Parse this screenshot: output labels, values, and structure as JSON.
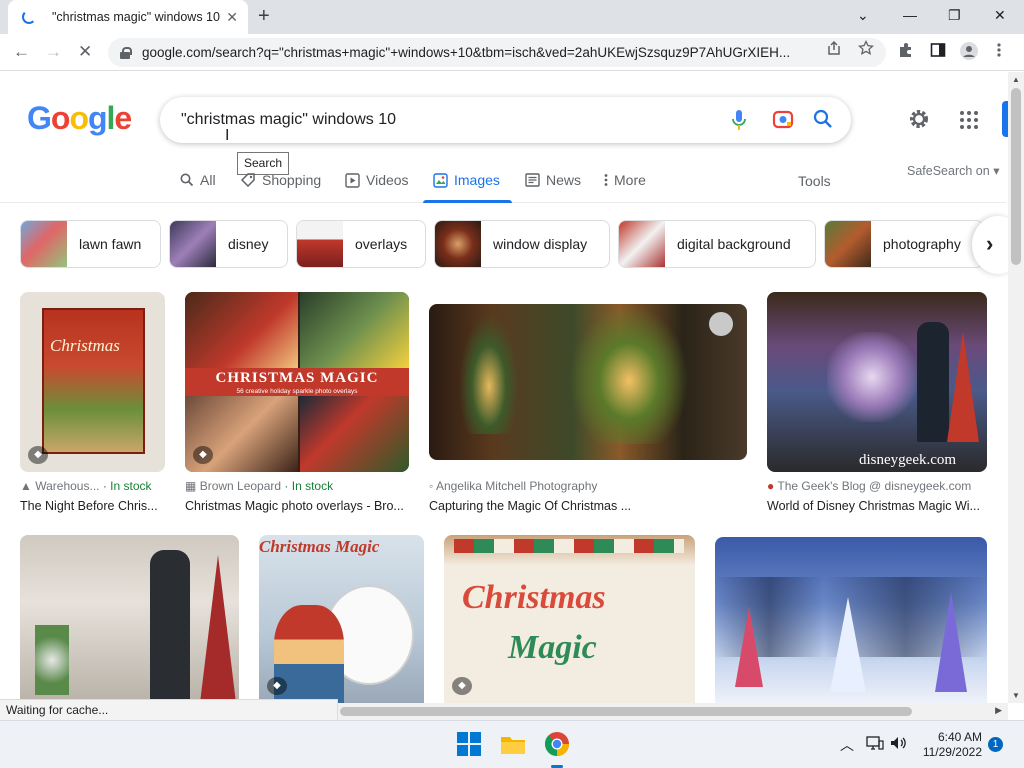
{
  "browser": {
    "tab_title": "\"christmas magic\" windows 10 -",
    "tab_close": "✕",
    "new_tab": "+",
    "window_controls": {
      "dropdown": "⌄",
      "minimize": "—",
      "restore": "❐",
      "close": "✕"
    },
    "url": "google.com/search?q=\"christmas+magic\"+windows+10&tbm=isch&ved=2ahUKEwjSzsquz9P7AhUGrXIEH...",
    "nav": {
      "back": "←",
      "forward": "→",
      "stop": "✕"
    }
  },
  "google": {
    "logo": [
      "G",
      "o",
      "o",
      "g",
      "l",
      "e"
    ],
    "logo_colors": [
      "#4285f4",
      "#ea4335",
      "#fbbc05",
      "#4285f4",
      "#34a853",
      "#ea4335"
    ],
    "query": "\"christmas magic\" windows 10",
    "tooltip": "Search",
    "tabs": [
      {
        "label": "All",
        "icon": "search-icon"
      },
      {
        "label": "Shopping",
        "icon": "tag-icon"
      },
      {
        "label": "Videos",
        "icon": "play-icon"
      },
      {
        "label": "Images",
        "icon": "image-icon",
        "active": true
      },
      {
        "label": "News",
        "icon": "news-icon"
      },
      {
        "label": "More",
        "icon": "more-icon"
      }
    ],
    "tools": "Tools",
    "safesearch": "SafeSearch on"
  },
  "chips": [
    "lawn fawn",
    "disney",
    "overlays",
    "window display",
    "digital background",
    "photography"
  ],
  "results_row1": [
    {
      "source": "Warehous...",
      "stock": "· In stock",
      "caption": "The Night Before Chris...",
      "overlay": "Christmas"
    },
    {
      "source": "Brown Leopard",
      "stock": "· In stock",
      "caption": "Christmas Magic photo overlays - Bro...",
      "overlay": "CHRISTMAS MAGIC",
      "overlay_sub": "56 creative holiday sparkle photo overlays"
    },
    {
      "source": "Angelika Mitchell Photography",
      "stock": "",
      "caption": "Capturing the Magic Of Christmas ...",
      "overlay": ""
    },
    {
      "source": "The Geek's Blog @ disneygeek.com",
      "stock": "",
      "caption": "World of Disney Christmas Magic Wi...",
      "overlay": "disneygeek.com"
    }
  ],
  "results_row2": [
    {
      "overlay": ""
    },
    {
      "overlay": "Christmas Magic"
    },
    {
      "overlay": "Christmas",
      "overlay2": "Magic"
    },
    {
      "overlay": ""
    }
  ],
  "status": "Waiting for cache...",
  "taskbar": {
    "time": "6:40 AM",
    "date": "11/29/2022",
    "notifications": "1"
  }
}
